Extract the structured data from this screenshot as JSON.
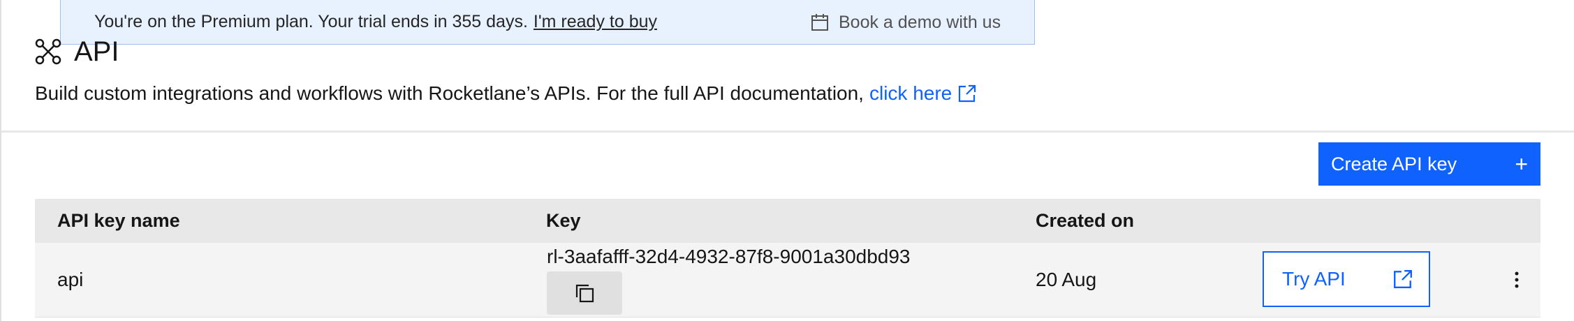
{
  "banner": {
    "message": "You're on the Premium plan. Your trial ends in 355 days.",
    "buy_link": "I'm ready to buy",
    "demo_link": "Book a demo with us"
  },
  "page": {
    "title": "API",
    "description": "Build custom integrations and workflows with Rocketlane’s APIs. For the full API documentation,",
    "doc_link": "click here"
  },
  "actions": {
    "create_label": "Create API key"
  },
  "table": {
    "headers": [
      "API key name",
      "Key",
      "Created on"
    ],
    "rows": [
      {
        "name": "api",
        "key": "rl-3aafafff-32d4-4932-87f8-9001a30dbd93",
        "created": "20 Aug",
        "try_label": "Try API"
      }
    ]
  },
  "colors": {
    "accent": "#0f62fe",
    "banner_bg": "#e8f1fe",
    "header_bg": "#e8e8e8"
  }
}
